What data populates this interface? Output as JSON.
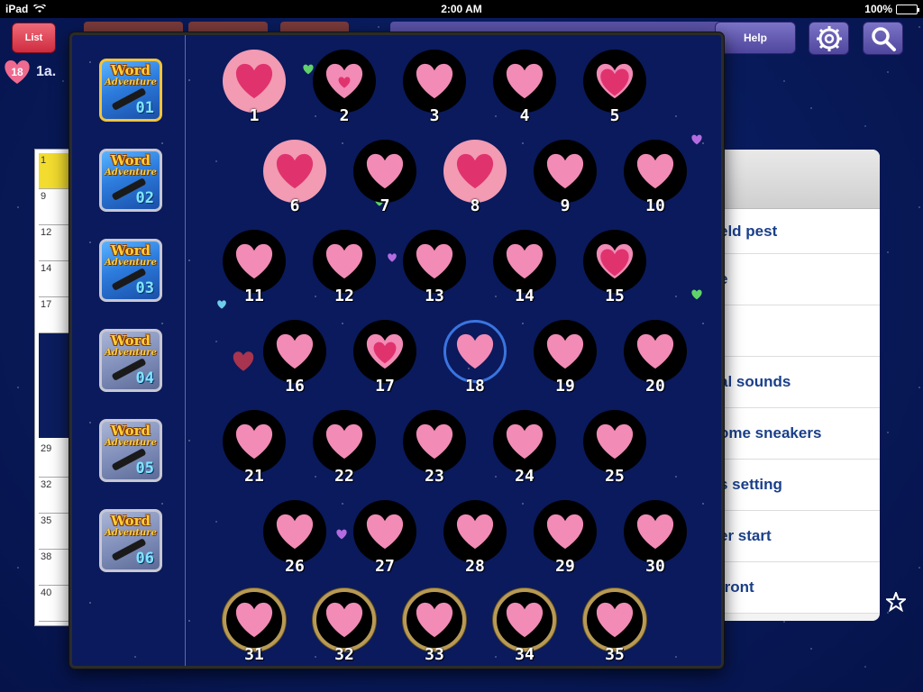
{
  "status_bar": {
    "device": "iPad",
    "time": "2:00 AM",
    "battery": "100%"
  },
  "toolbar": {
    "list_label": "List",
    "help_label": "Help",
    "settings_icon": "gear-icon",
    "search_icon": "search-icon"
  },
  "clue_header": {
    "badge_number": "18",
    "current_clue": "1a."
  },
  "grid": {
    "cells": [
      "1",
      "9",
      "12",
      "14",
      "17",
      "",
      "29",
      "32",
      "35",
      "38",
      "40"
    ]
  },
  "clue_list": {
    "items": [
      "eld pest",
      "e",
      "",
      "al sounds",
      "ome sneakers",
      "s setting",
      "er start",
      " front"
    ]
  },
  "episodes": [
    {
      "title": "Word",
      "subtitle": "Adventure",
      "number": "01",
      "selected": true
    },
    {
      "title": "Word",
      "subtitle": "Adventure",
      "number": "02",
      "selected": false
    },
    {
      "title": "Word",
      "subtitle": "Adventure",
      "number": "03",
      "selected": false
    },
    {
      "title": "Word",
      "subtitle": "Adventure",
      "number": "04",
      "selected": false
    },
    {
      "title": "Word",
      "subtitle": "Adventure",
      "number": "05",
      "selected": false
    },
    {
      "title": "Word",
      "subtitle": "Adventure",
      "number": "06",
      "selected": false
    }
  ],
  "levels": [
    {
      "number": "1",
      "style": "pink",
      "heart": "filled"
    },
    {
      "number": "2",
      "style": "black",
      "heart": "small"
    },
    {
      "number": "3",
      "style": "black",
      "heart": "plain"
    },
    {
      "number": "4",
      "style": "black",
      "heart": "plain"
    },
    {
      "number": "5",
      "style": "black",
      "heart": "filled"
    },
    {
      "number": "6",
      "style": "pink",
      "heart": "filled"
    },
    {
      "number": "7",
      "style": "black",
      "heart": "plain"
    },
    {
      "number": "8",
      "style": "pink",
      "heart": "filled"
    },
    {
      "number": "9",
      "style": "black",
      "heart": "plain"
    },
    {
      "number": "10",
      "style": "black",
      "heart": "plain"
    },
    {
      "number": "11",
      "style": "black",
      "heart": "plain"
    },
    {
      "number": "12",
      "style": "black",
      "heart": "plain"
    },
    {
      "number": "13",
      "style": "black",
      "heart": "plain"
    },
    {
      "number": "14",
      "style": "black",
      "heart": "plain"
    },
    {
      "number": "15",
      "style": "black",
      "heart": "filled"
    },
    {
      "number": "16",
      "style": "black",
      "heart": "plain"
    },
    {
      "number": "17",
      "style": "black",
      "heart": "mid"
    },
    {
      "number": "18",
      "style": "current",
      "heart": "plain"
    },
    {
      "number": "19",
      "style": "black",
      "heart": "plain"
    },
    {
      "number": "20",
      "style": "black",
      "heart": "plain"
    },
    {
      "number": "21",
      "style": "black",
      "heart": "plain"
    },
    {
      "number": "22",
      "style": "black",
      "heart": "plain"
    },
    {
      "number": "23",
      "style": "black",
      "heart": "plain"
    },
    {
      "number": "24",
      "style": "black",
      "heart": "plain"
    },
    {
      "number": "25",
      "style": "black",
      "heart": "plain"
    },
    {
      "number": "26",
      "style": "black",
      "heart": "plain"
    },
    {
      "number": "27",
      "style": "black",
      "heart": "plain"
    },
    {
      "number": "28",
      "style": "black",
      "heart": "plain"
    },
    {
      "number": "29",
      "style": "black",
      "heart": "plain"
    },
    {
      "number": "30",
      "style": "black",
      "heart": "plain"
    },
    {
      "number": "31",
      "style": "gold",
      "heart": "plain"
    },
    {
      "number": "32",
      "style": "gold",
      "heart": "plain"
    },
    {
      "number": "33",
      "style": "gold",
      "heart": "plain"
    },
    {
      "number": "34",
      "style": "gold",
      "heart": "plain"
    },
    {
      "number": "35",
      "style": "gold",
      "heart": "plain"
    }
  ],
  "colors": {
    "heart_pink": "#f28bb6",
    "heart_deep": "#e0336e",
    "gold_ring": "#b89a55",
    "current_ring": "#3a74e0",
    "list_button": "#d9384c",
    "purple_button": "#5e55ad"
  }
}
